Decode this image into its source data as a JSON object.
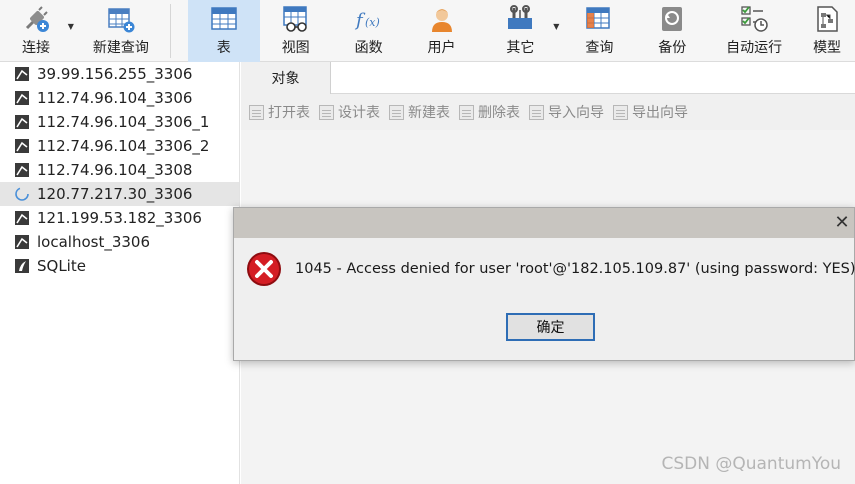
{
  "toolbar": {
    "connect": "连接",
    "new_query": "新建查询",
    "table": "表",
    "view": "视图",
    "function": "函数",
    "user": "用户",
    "other": "其它",
    "query": "查询",
    "backup": "备份",
    "automation": "自动运行",
    "model": "模型"
  },
  "sidebar": {
    "connections": [
      {
        "label": "39.99.156.255_3306",
        "icon": "mysql-connection-icon"
      },
      {
        "label": "112.74.96.104_3306",
        "icon": "mysql-connection-icon"
      },
      {
        "label": "112.74.96.104_3306_1",
        "icon": "mysql-connection-icon"
      },
      {
        "label": "112.74.96.104_3306_2",
        "icon": "mysql-connection-icon"
      },
      {
        "label": "112.74.96.104_3308",
        "icon": "mysql-connection-icon"
      },
      {
        "label": "120.77.217.30_3306",
        "icon": "loading-spinner-icon"
      },
      {
        "label": "121.199.53.182_3306",
        "icon": "mysql-connection-icon"
      },
      {
        "label": "localhost_3306",
        "icon": "mysql-connection-icon"
      },
      {
        "label": "SQLite",
        "icon": "sqlite-connection-icon"
      }
    ]
  },
  "main": {
    "tab": "对象",
    "object_tools": [
      "打开表",
      "设计表",
      "新建表",
      "删除表",
      "导入向导",
      "导出向导"
    ]
  },
  "dialog": {
    "message": "1045 - Access denied for user 'root'@'182.105.109.87' (using password: YES)",
    "ok_label": "确定",
    "close_glyph": "✕"
  },
  "watermark": "CSDN @QuantumYou",
  "colors": {
    "active_tab_bg": "#cfe3f7",
    "accent_blue": "#2e6db5",
    "error_red": "#c0131a"
  }
}
